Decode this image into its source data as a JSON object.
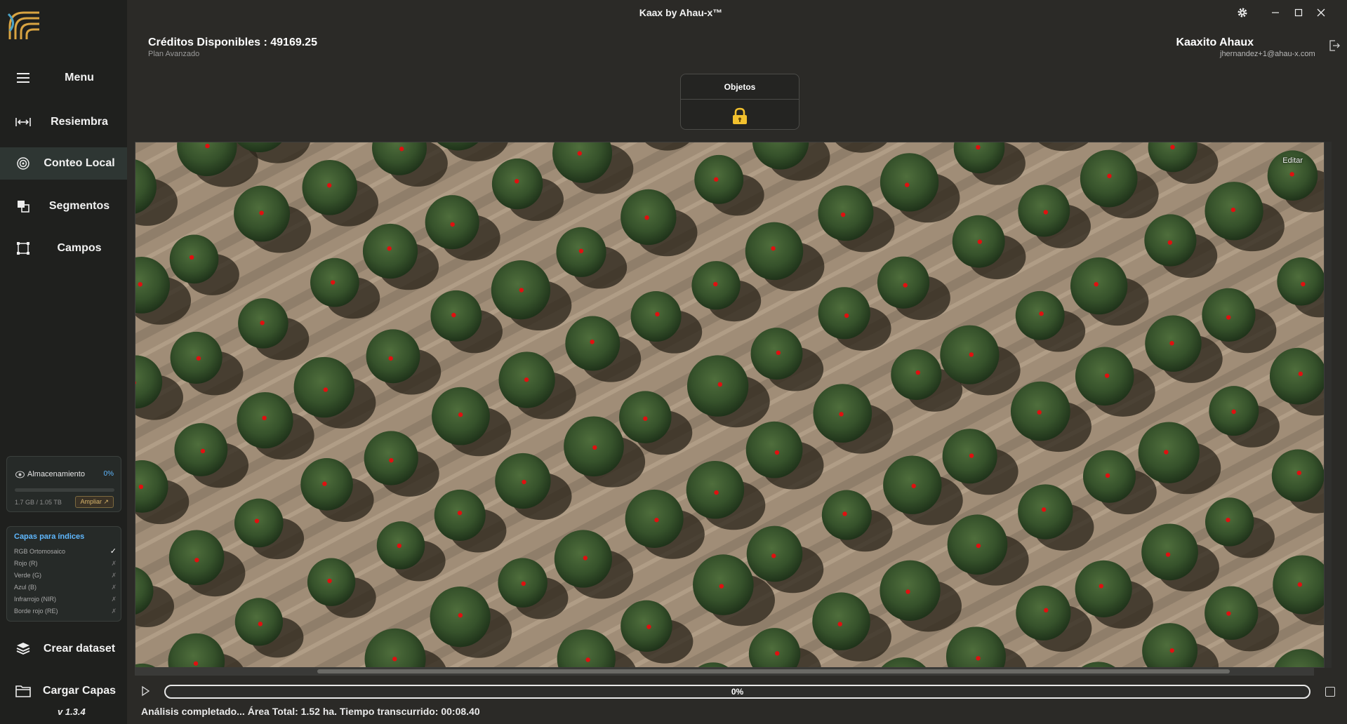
{
  "window": {
    "title": "Kaax by Ahau-x™"
  },
  "header": {
    "credits": "Créditos Disponibles : 49169.25",
    "plan": "Plan Avanzado",
    "user_name": "Kaaxito Ahaux",
    "user_email": "jhernandez+1@ahau-x.com"
  },
  "sidebar": {
    "items": [
      {
        "label": "Menu",
        "icon": "hamburger-icon"
      },
      {
        "label": "Resiembra",
        "icon": "horizontal-arrows-icon"
      },
      {
        "label": "Conteo Local",
        "icon": "target-icon",
        "active": true
      },
      {
        "label": "Segmentos",
        "icon": "overlap-squares-icon"
      },
      {
        "label": "Campos",
        "icon": "crop-square-icon"
      },
      {
        "label": "Crear dataset",
        "icon": "stack-icon"
      },
      {
        "label": "Cargar Capas",
        "icon": "folder-icon"
      }
    ],
    "storage": {
      "title": "Almacenamiento",
      "percent": "0%",
      "percent_value": 0.0,
      "size": "1.7 GB / 1.05 TB",
      "upgrade": "Ampliar ↗"
    },
    "layers": {
      "title": "Capas para índices",
      "items": [
        {
          "label": "RGB Ortomosaico",
          "mark": "✓",
          "enabled": true
        },
        {
          "label": "Rojo (R)",
          "mark": "✗",
          "enabled": false
        },
        {
          "label": "Verde (G)",
          "mark": "✗",
          "enabled": false
        },
        {
          "label": "Azul (B)",
          "mark": "✗",
          "enabled": false
        },
        {
          "label": "Infrarrojo (NIR)",
          "mark": "✗",
          "enabled": false
        },
        {
          "label": "Borde rojo (RE)",
          "mark": "✗",
          "enabled": false
        }
      ]
    },
    "version": "v 1.3.4"
  },
  "objects_panel": {
    "title": "Objetos",
    "icon": "lock-icon"
  },
  "map": {
    "edit_label": "Editar"
  },
  "progress": {
    "label": "0%",
    "value": 0
  },
  "status": "Análisis completado... Área Total: 1.52 ha. Tiempo transcurrido: 00:08.40",
  "colors": {
    "accent": "#5fb8ff",
    "sidebar_bg": "#1f201e",
    "main_bg": "#2b2a27",
    "detection_dot": "#e01010",
    "lock": "#f2c12e"
  }
}
